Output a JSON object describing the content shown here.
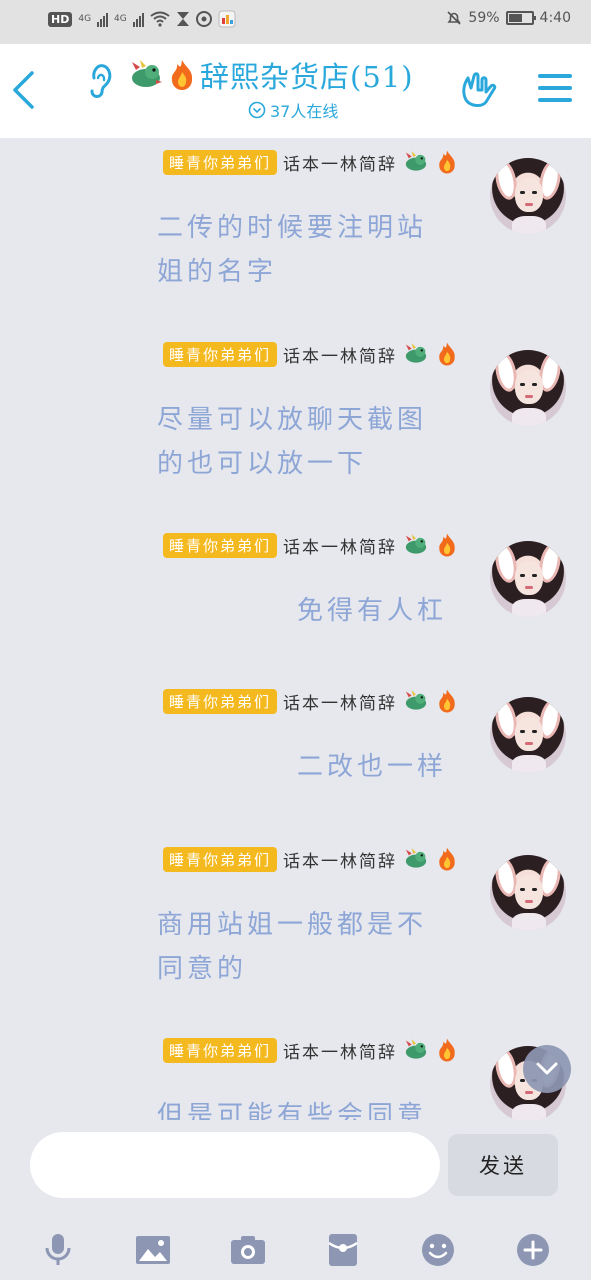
{
  "status_bar": {
    "hd": "HD",
    "sim1": "4G",
    "sim2": "4G",
    "battery": "59%",
    "battery_level": 0.59,
    "time": "4:40"
  },
  "header": {
    "title": "辞熙杂货店(51)",
    "online_text": "37人在线",
    "accent": "#2aa8dc"
  },
  "messages": [
    {
      "badge": "睡青你弟弟们",
      "sender": "话本一林简辞",
      "text": "二传的时候要注明站姐的名字",
      "align": "left"
    },
    {
      "badge": "睡青你弟弟们",
      "sender": "话本一林简辞",
      "text": "尽量可以放聊天截图的也可以放一下",
      "align": "left"
    },
    {
      "badge": "睡青你弟弟们",
      "sender": "话本一林简辞",
      "text": "免得有人杠",
      "align": "right"
    },
    {
      "badge": "睡青你弟弟们",
      "sender": "话本一林简辞",
      "text": "二改也一样",
      "align": "right"
    },
    {
      "badge": "睡青你弟弟们",
      "sender": "话本一林简辞",
      "text": "商用站姐一般都是不同意的",
      "align": "left"
    },
    {
      "badge": "睡青你弟弟们",
      "sender": "话本一林简辞",
      "text": "但是可能有些会同意",
      "align": "left"
    }
  ],
  "input": {
    "placeholder": "",
    "value": "",
    "send_label": "发送"
  },
  "toolbar": {
    "icons": [
      "microphone-icon",
      "image-icon",
      "camera-icon",
      "red-packet-icon",
      "emoji-icon",
      "plus-icon"
    ]
  },
  "colors": {
    "badge": "#f5b920",
    "message_text": "#8ea6d6",
    "background": "#e6e8ee"
  }
}
